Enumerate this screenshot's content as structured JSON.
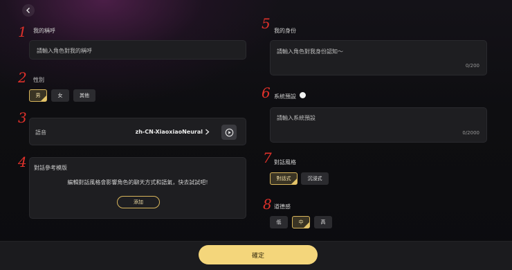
{
  "annotations": [
    "1",
    "2",
    "3",
    "4",
    "5",
    "6",
    "7",
    "8"
  ],
  "nickname": {
    "label": "我的稱呼",
    "placeholder": "請輸入角色對我的稱呼"
  },
  "gender": {
    "label": "性別",
    "options": [
      "男",
      "女",
      "其他"
    ],
    "selected": "男"
  },
  "voice": {
    "label": "語音",
    "value": "zh-CN-XiaoxiaoNeural"
  },
  "dialogue_template": {
    "label": "對話參考模版",
    "description": "編輯對話風格會影響角色的聊天方式和語氣，快去試試吧!",
    "add_button": "添加"
  },
  "identity": {
    "label": "我的身份",
    "placeholder": "請輸入角色對我身份認知～",
    "counter": "0/200"
  },
  "system_preset": {
    "label": "系統預設",
    "placeholder": "請輸入系統預設",
    "counter": "0/2000"
  },
  "dialogue_style": {
    "label": "對話風格",
    "options": [
      "對話式",
      "沉浸式"
    ],
    "selected": "對話式"
  },
  "moral_sense": {
    "label": "道德感",
    "options": [
      "低",
      "中",
      "高"
    ],
    "selected": "中"
  },
  "confirm_button": "確定",
  "colors": {
    "accent": "#f4d67b",
    "annotation": "#e0312a",
    "field_bg": "#1e1e21"
  }
}
